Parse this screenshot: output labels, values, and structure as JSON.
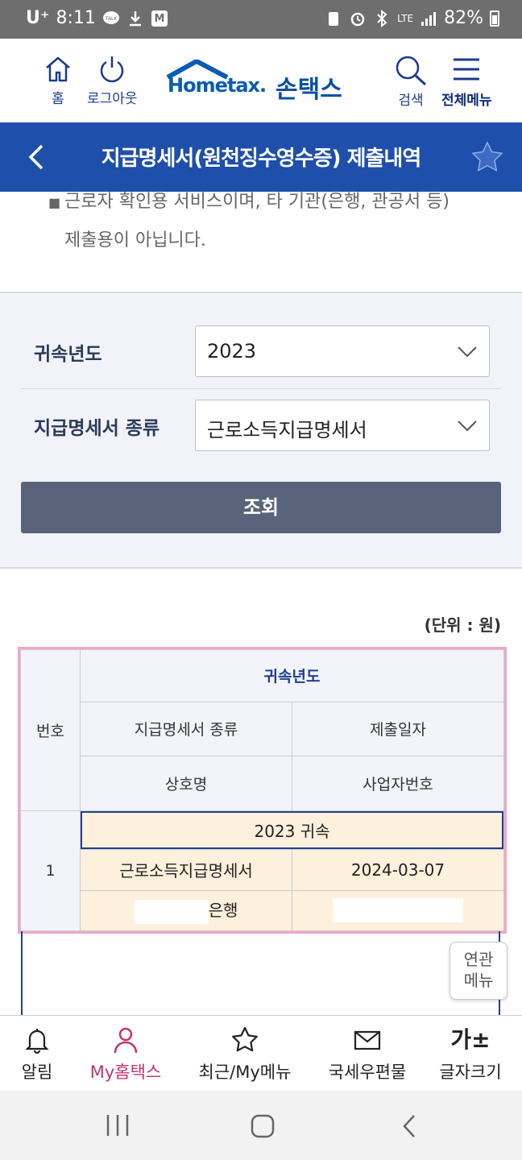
{
  "status_bar": {
    "carrier": "U⁺",
    "time": "8:11",
    "network": "LTE",
    "battery": "82%"
  },
  "header": {
    "home_label": "홈",
    "logout_label": "로그아웃",
    "logo_text_en": "Hometax.",
    "logo_text_kr": "손택스",
    "search_label": "검색",
    "menu_label": "전체메뉴"
  },
  "title_bar": {
    "title": "지급명세서(원천징수영수증) 제출내역"
  },
  "notice": {
    "line1": "근로자 확인용 서비스이며, 타 기관(은행, 관공서 등)",
    "line2": "제출용이 아닙니다."
  },
  "filter": {
    "year_label": "귀속년도",
    "year_value": "2023",
    "type_label": "지급명세서 종류",
    "type_value": "근로소득지급명세서",
    "search_button": "조회"
  },
  "results": {
    "unit": "(단위 : 원)",
    "headers": {
      "no": "번호",
      "year": "귀속년도",
      "type": "지급명세서 종류",
      "date": "제출일자",
      "company": "상호명",
      "business_no": "사업자번호"
    },
    "rows": [
      {
        "no": "1",
        "year": "2023 귀속",
        "type": "근로소득지급명세서",
        "date": "2024-03-07",
        "company_suffix": "은행"
      }
    ]
  },
  "related_menu": {
    "line1": "연관",
    "line2": "메뉴"
  },
  "bottom_nav": {
    "items": [
      {
        "label": "알림",
        "icon": "bell-icon"
      },
      {
        "label": "My홈택스",
        "icon": "person-icon",
        "active": true
      },
      {
        "label": "최근/My메뉴",
        "icon": "star-icon"
      },
      {
        "label": "국세우편물",
        "icon": "mail-icon"
      },
      {
        "label": "글자크기",
        "icon": "font-size-icon"
      }
    ],
    "font_size_glyph": "가±"
  },
  "colors": {
    "title_bar": "#1e4faa",
    "accent_pink": "#c2356b",
    "search_button": "#59637a",
    "row_highlight": "#fdf0dc"
  }
}
